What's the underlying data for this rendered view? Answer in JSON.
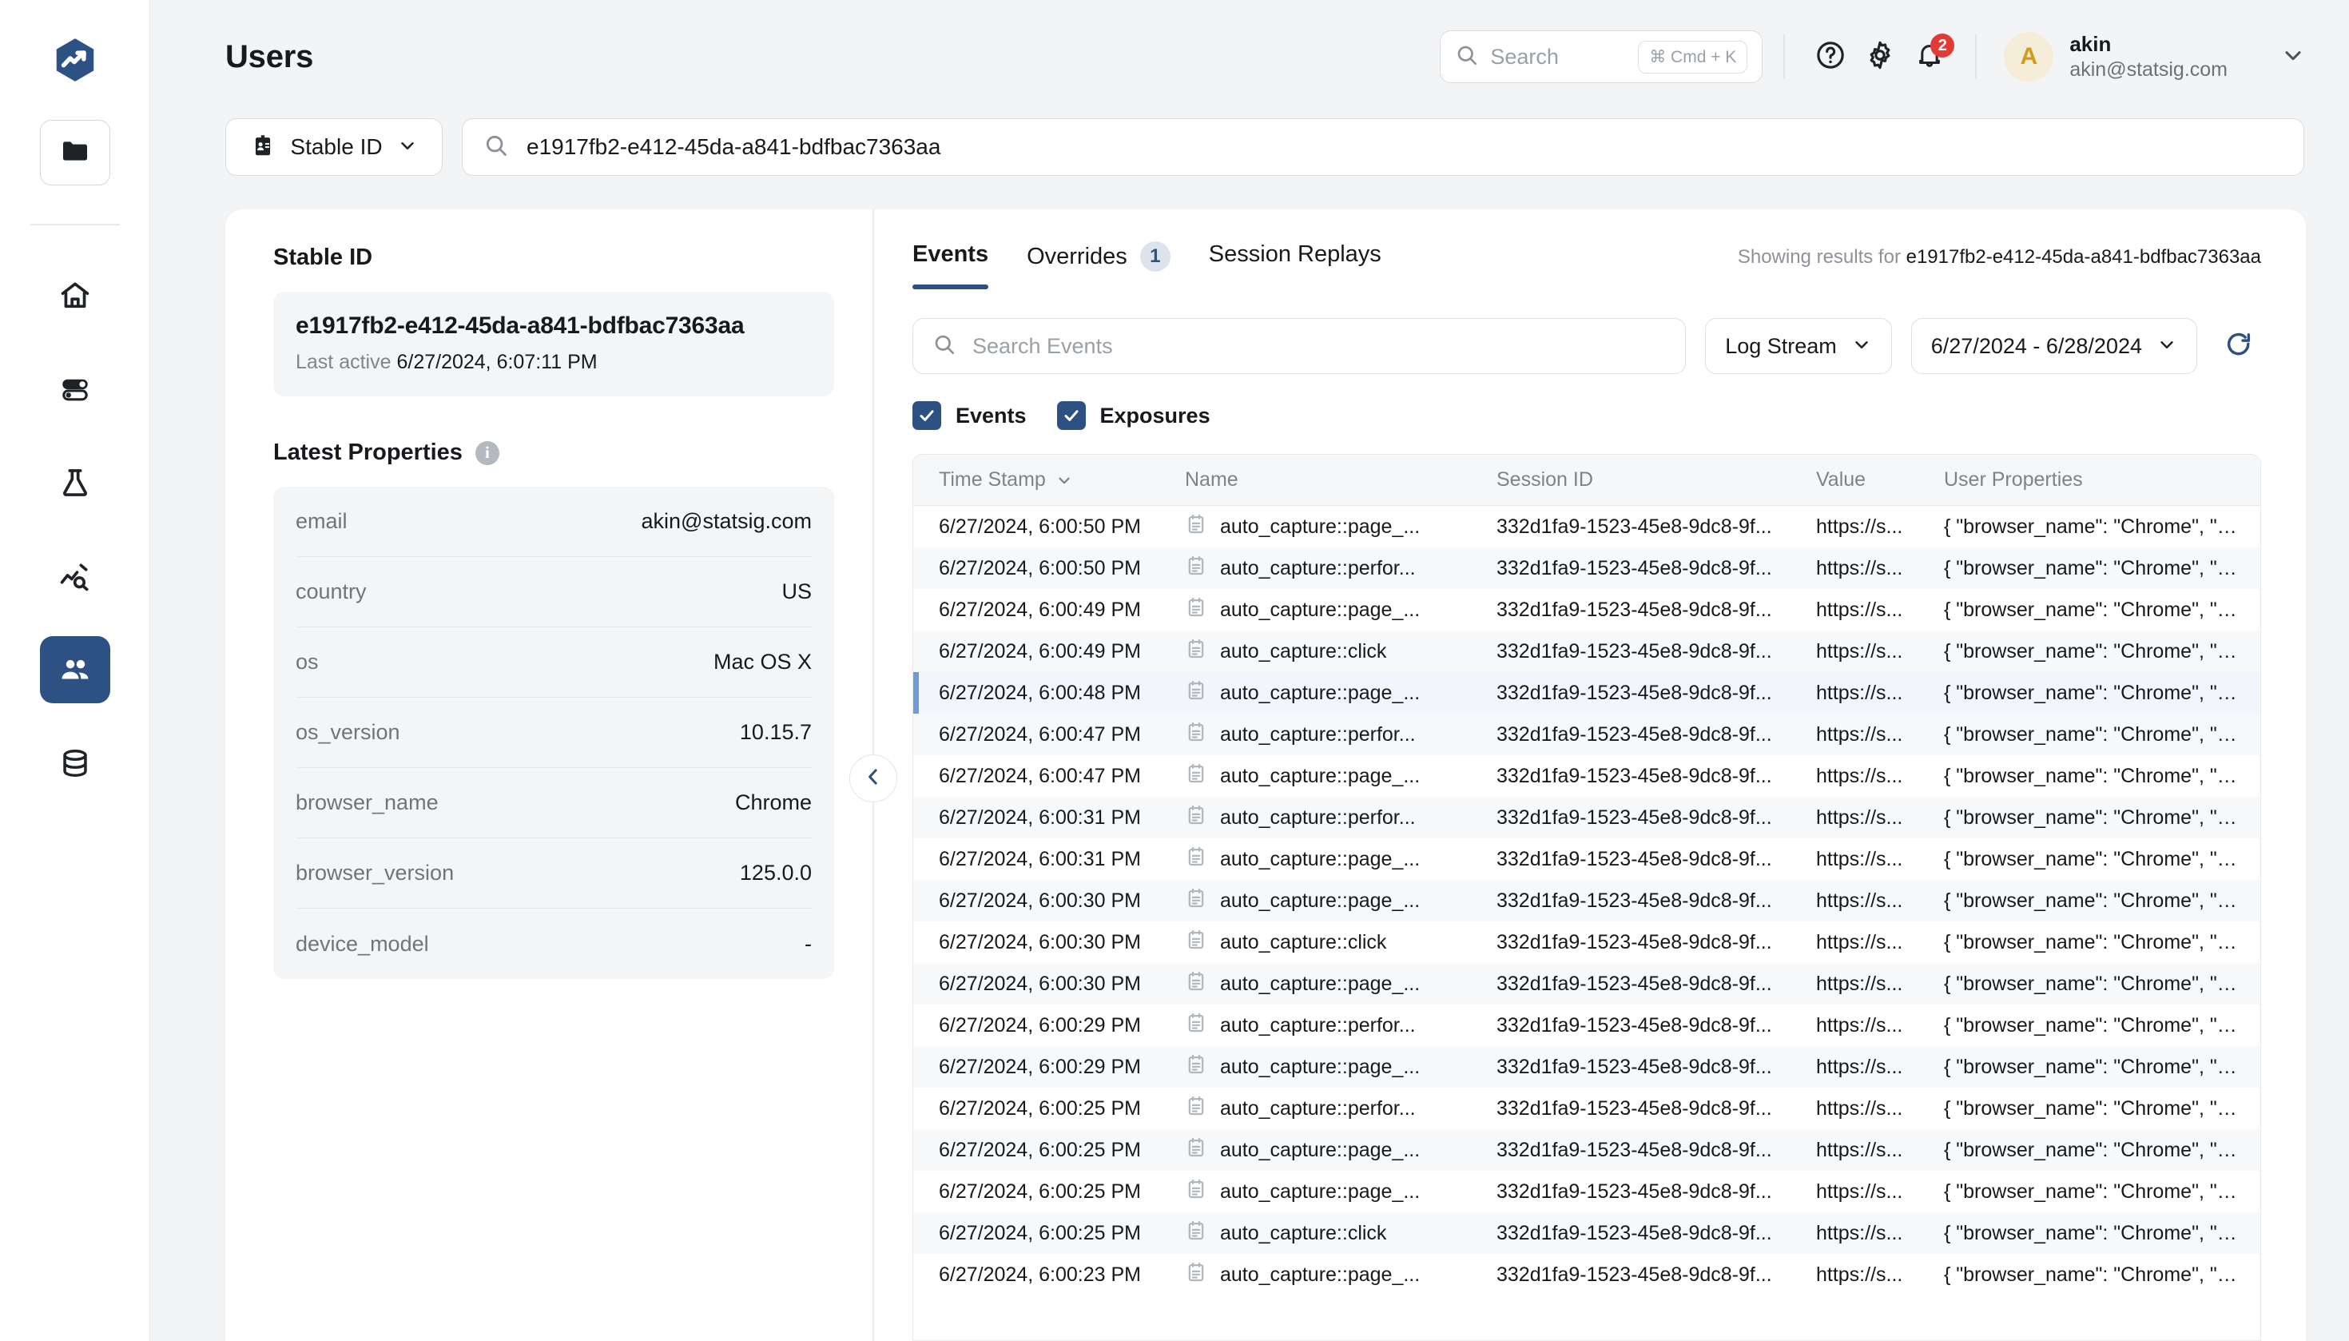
{
  "brand": {
    "accent": "#2d5182",
    "danger": "#e23b35",
    "avatar_bg": "#f6edd9",
    "avatar_fg": "#d19b1e"
  },
  "sidebar": {
    "logo_icon": "statsig-logo-icon",
    "project_icon": "folder-icon",
    "items": [
      {
        "icon": "home-icon",
        "name": "home",
        "active": false
      },
      {
        "icon": "feature-gates-toggles-icon",
        "name": "feature-gates",
        "active": false
      },
      {
        "icon": "flask-experiments-icon",
        "name": "experiments",
        "active": false
      },
      {
        "icon": "metrics-explore-icon",
        "name": "metrics",
        "active": false
      },
      {
        "icon": "users-icon",
        "name": "users",
        "active": true
      },
      {
        "icon": "database-icon",
        "name": "data",
        "active": false
      }
    ]
  },
  "header": {
    "title": "Users",
    "search": {
      "placeholder": "Search",
      "shortcut": "⌘ Cmd + K",
      "icon": "search-icon"
    },
    "help_icon": "help-circle-icon",
    "settings_icon": "gear-icon",
    "notifications_icon": "bell-icon",
    "notifications_count": "2",
    "user": {
      "initial": "A",
      "name": "akin",
      "email": "akin@statsig.com",
      "chevron_icon": "chevron-down-icon"
    }
  },
  "search_row": {
    "id_type": {
      "label": "Stable ID",
      "icon": "id-badge-icon",
      "chevron_icon": "chevron-down-icon"
    },
    "query": {
      "value": "e1917fb2-e412-45da-a841-bdfbac7363aa",
      "icon": "search-icon"
    }
  },
  "left_panel": {
    "section_title": "Stable ID",
    "id_value": "e1917fb2-e412-45da-a841-bdfbac7363aa",
    "last_active_label": "Last active",
    "last_active_value": "6/27/2024, 6:07:11 PM",
    "properties_title": "Latest Properties",
    "properties_info_icon": "info-icon",
    "properties": [
      {
        "key": "email",
        "value": "akin@statsig.com"
      },
      {
        "key": "country",
        "value": "US"
      },
      {
        "key": "os",
        "value": "Mac OS X"
      },
      {
        "key": "os_version",
        "value": "10.15.7"
      },
      {
        "key": "browser_name",
        "value": "Chrome"
      },
      {
        "key": "browser_version",
        "value": "125.0.0"
      },
      {
        "key": "device_model",
        "value": "-"
      }
    ],
    "collapse_icon": "chevron-left-icon"
  },
  "right_panel": {
    "tabs": [
      {
        "label": "Events",
        "badge": null,
        "active": true
      },
      {
        "label": "Overrides",
        "badge": "1",
        "active": false
      },
      {
        "label": "Session Replays",
        "badge": null,
        "active": false
      }
    ],
    "showing_prefix": "Showing results for",
    "showing_value": "e1917fb2-e412-45da-a841-bdfbac7363aa",
    "event_search_placeholder": "Search Events",
    "event_search_icon": "search-icon",
    "log_stream": {
      "label": "Log Stream",
      "chevron_icon": "chevron-down-icon"
    },
    "date_range": {
      "label": "6/27/2024 - 6/28/2024",
      "chevron_icon": "chevron-down-icon"
    },
    "refresh_icon": "refresh-icon",
    "checkboxes": [
      {
        "label": "Events",
        "checked": true
      },
      {
        "label": "Exposures",
        "checked": true
      }
    ],
    "table": {
      "columns": [
        "Time Stamp",
        "Name",
        "Session ID",
        "Value",
        "User Properties"
      ],
      "sort_column": "Time Stamp",
      "sort_icon": "chevron-down-icon",
      "row_icon": "event-log-icon",
      "rows": [
        {
          "ts": "6/27/2024, 6:00:50 PM",
          "name": "auto_capture::page_...",
          "session": "332d1fa9-1523-45e8-9dc8-9f...",
          "value": "https://s...",
          "props": "{ \"browser_name\": \"Chrome\", \"bro...",
          "selected": false
        },
        {
          "ts": "6/27/2024, 6:00:50 PM",
          "name": "auto_capture::perfor...",
          "session": "332d1fa9-1523-45e8-9dc8-9f...",
          "value": "https://s...",
          "props": "{ \"browser_name\": \"Chrome\", \"bro...",
          "selected": false
        },
        {
          "ts": "6/27/2024, 6:00:49 PM",
          "name": "auto_capture::page_...",
          "session": "332d1fa9-1523-45e8-9dc8-9f...",
          "value": "https://s...",
          "props": "{ \"browser_name\": \"Chrome\", \"bro...",
          "selected": false
        },
        {
          "ts": "6/27/2024, 6:00:49 PM",
          "name": "auto_capture::click",
          "session": "332d1fa9-1523-45e8-9dc8-9f...",
          "value": "https://s...",
          "props": "{ \"browser_name\": \"Chrome\", \"bro...",
          "selected": false
        },
        {
          "ts": "6/27/2024, 6:00:48 PM",
          "name": "auto_capture::page_...",
          "session": "332d1fa9-1523-45e8-9dc8-9f...",
          "value": "https://s...",
          "props": "{ \"browser_name\": \"Chrome\", \"bro...",
          "selected": true
        },
        {
          "ts": "6/27/2024, 6:00:47 PM",
          "name": "auto_capture::perfor...",
          "session": "332d1fa9-1523-45e8-9dc8-9f...",
          "value": "https://s...",
          "props": "{ \"browser_name\": \"Chrome\", \"bro...",
          "selected": false
        },
        {
          "ts": "6/27/2024, 6:00:47 PM",
          "name": "auto_capture::page_...",
          "session": "332d1fa9-1523-45e8-9dc8-9f...",
          "value": "https://s...",
          "props": "{ \"browser_name\": \"Chrome\", \"bro...",
          "selected": false
        },
        {
          "ts": "6/27/2024, 6:00:31 PM",
          "name": "auto_capture::perfor...",
          "session": "332d1fa9-1523-45e8-9dc8-9f...",
          "value": "https://s...",
          "props": "{ \"browser_name\": \"Chrome\", \"bro...",
          "selected": false
        },
        {
          "ts": "6/27/2024, 6:00:31 PM",
          "name": "auto_capture::page_...",
          "session": "332d1fa9-1523-45e8-9dc8-9f...",
          "value": "https://s...",
          "props": "{ \"browser_name\": \"Chrome\", \"bro...",
          "selected": false
        },
        {
          "ts": "6/27/2024, 6:00:30 PM",
          "name": "auto_capture::page_...",
          "session": "332d1fa9-1523-45e8-9dc8-9f...",
          "value": "https://s...",
          "props": "{ \"browser_name\": \"Chrome\", \"bro...",
          "selected": false
        },
        {
          "ts": "6/27/2024, 6:00:30 PM",
          "name": "auto_capture::click",
          "session": "332d1fa9-1523-45e8-9dc8-9f...",
          "value": "https://s...",
          "props": "{ \"browser_name\": \"Chrome\", \"bro...",
          "selected": false
        },
        {
          "ts": "6/27/2024, 6:00:30 PM",
          "name": "auto_capture::page_...",
          "session": "332d1fa9-1523-45e8-9dc8-9f...",
          "value": "https://s...",
          "props": "{ \"browser_name\": \"Chrome\", \"bro...",
          "selected": false
        },
        {
          "ts": "6/27/2024, 6:00:29 PM",
          "name": "auto_capture::perfor...",
          "session": "332d1fa9-1523-45e8-9dc8-9f...",
          "value": "https://s...",
          "props": "{ \"browser_name\": \"Chrome\", \"bro...",
          "selected": false
        },
        {
          "ts": "6/27/2024, 6:00:29 PM",
          "name": "auto_capture::page_...",
          "session": "332d1fa9-1523-45e8-9dc8-9f...",
          "value": "https://s...",
          "props": "{ \"browser_name\": \"Chrome\", \"bro...",
          "selected": false
        },
        {
          "ts": "6/27/2024, 6:00:25 PM",
          "name": "auto_capture::perfor...",
          "session": "332d1fa9-1523-45e8-9dc8-9f...",
          "value": "https://s...",
          "props": "{ \"browser_name\": \"Chrome\", \"bro...",
          "selected": false
        },
        {
          "ts": "6/27/2024, 6:00:25 PM",
          "name": "auto_capture::page_...",
          "session": "332d1fa9-1523-45e8-9dc8-9f...",
          "value": "https://s...",
          "props": "{ \"browser_name\": \"Chrome\", \"bro...",
          "selected": false
        },
        {
          "ts": "6/27/2024, 6:00:25 PM",
          "name": "auto_capture::page_...",
          "session": "332d1fa9-1523-45e8-9dc8-9f...",
          "value": "https://s...",
          "props": "{ \"browser_name\": \"Chrome\", \"bro...",
          "selected": false
        },
        {
          "ts": "6/27/2024, 6:00:25 PM",
          "name": "auto_capture::click",
          "session": "332d1fa9-1523-45e8-9dc8-9f...",
          "value": "https://s...",
          "props": "{ \"browser_name\": \"Chrome\", \"bro...",
          "selected": false
        },
        {
          "ts": "6/27/2024, 6:00:23 PM",
          "name": "auto_capture::page_...",
          "session": "332d1fa9-1523-45e8-9dc8-9f...",
          "value": "https://s...",
          "props": "{ \"browser_name\": \"Chrome\", \"bro...",
          "selected": false
        }
      ]
    }
  }
}
